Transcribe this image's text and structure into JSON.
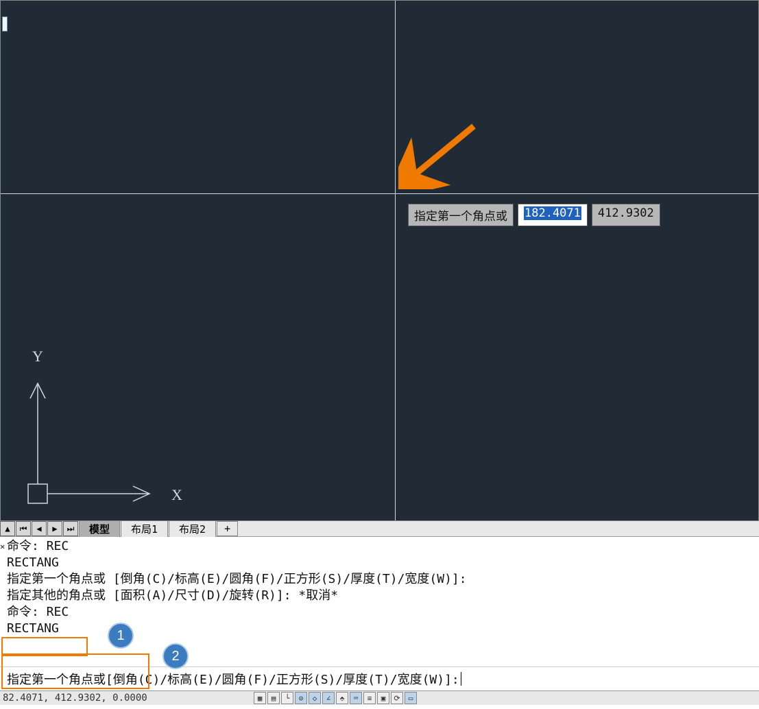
{
  "canvas": {
    "tooltip_label": "指定第一个角点或",
    "tooltip_x": "182.4071",
    "tooltip_y": "412.9302"
  },
  "ucs": {
    "x_label": "X",
    "y_label": "Y"
  },
  "tabs": {
    "model": "模型",
    "layout1": "布局1",
    "layout2": "布局2",
    "add": "+"
  },
  "history": {
    "l1": "命令: REC",
    "l2": "RECTANG",
    "l3": "指定第一个角点或 [倒角(C)/标高(E)/圆角(F)/正方形(S)/厚度(T)/宽度(W)]:",
    "l4": "指定其他的角点或 [面积(A)/尺寸(D)/旋转(R)]: *取消*",
    "l5": "命令: REC",
    "l6": "RECTANG"
  },
  "badges": {
    "one": "1",
    "two": "2"
  },
  "prompt": {
    "label": "指定第一个角点或 ",
    "opts": "[倒角(C)/标高(E)/圆角(F)/正方形(S)/厚度(T)/宽度(W)]:"
  },
  "status": {
    "coords": "82.4071, 412.9302, 0.0000"
  }
}
